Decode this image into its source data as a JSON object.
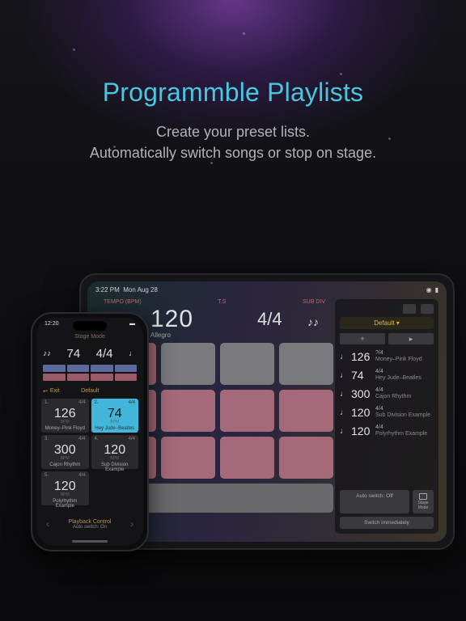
{
  "hero": {
    "title": "Programmble Playlists",
    "subtitle_l1": "Create your preset lists.",
    "subtitle_l2": "Automatically switch songs or stop on stage."
  },
  "ipad": {
    "status": {
      "time": "3:22 PM",
      "date": "Mon Aug 28",
      "wifi": "wifi",
      "battery": "76%"
    },
    "labels": {
      "tempo": "TEMPO (BPM)",
      "ts": "T.S",
      "subdiv": "SUB DIV"
    },
    "tempo": {
      "note": "♩",
      "bpm": "120",
      "name": "Allegro"
    },
    "timesig": "4/4",
    "subdiv": "♪♪",
    "sidebar": {
      "selector": "Default ▾",
      "add": "+",
      "play": "▸",
      "items": [
        {
          "note": "♩",
          "bpm": "126",
          "ts": "?/4",
          "title": "Money–Pink Floyd"
        },
        {
          "note": "♩",
          "bpm": "74",
          "ts": "4/4",
          "title": "Hey Jude–Beatles"
        },
        {
          "note": "♩",
          "bpm": "300",
          "ts": "4/4",
          "title": "Cajon Rhythm"
        },
        {
          "note": "♩",
          "bpm": "120",
          "ts": "4/4",
          "title": "Sub Division Example"
        },
        {
          "note": "♩",
          "bpm": "120",
          "ts": "4/4",
          "title": "Polyrhythm Example"
        }
      ],
      "auto_switch": "Auto switch: Off",
      "switch_now": "Switch immediately",
      "stage_mode": "Stage Mode"
    }
  },
  "iphone": {
    "status": {
      "time": "12:20",
      "signal": "•••",
      "battery": "batt"
    },
    "mode_title": "Stage Mode",
    "top": {
      "note_l": "♪♪",
      "bpm": "74",
      "ts": "4/4",
      "note_r": "♩"
    },
    "exit_icon": "↩",
    "exit_label": "Exit",
    "selector": "Default",
    "cards": [
      {
        "idx": "1.",
        "ts": "4/4",
        "bpm": "126",
        "unit": "BPM",
        "title": "Money–Pink Floyd",
        "active": false
      },
      {
        "idx": "2.",
        "ts": "4/4",
        "bpm": "74",
        "unit": "BPM",
        "title": "Hey Jude–Beatles",
        "active": true
      },
      {
        "idx": "3.",
        "ts": "4/4",
        "bpm": "300",
        "unit": "BPM",
        "title": "Cajon Rhythm",
        "active": false
      },
      {
        "idx": "4.",
        "ts": "4/4",
        "bpm": "120",
        "unit": "BPM",
        "title": "Sub Division Example",
        "active": false
      },
      {
        "idx": "5.",
        "ts": "4/4",
        "bpm": "120",
        "unit": "BPM",
        "title": "Polyrhythm Example",
        "active": false
      }
    ],
    "footer": {
      "line1": "Playback Control",
      "line2": "Auto switch: On"
    },
    "prev": "‹",
    "next": "›"
  }
}
